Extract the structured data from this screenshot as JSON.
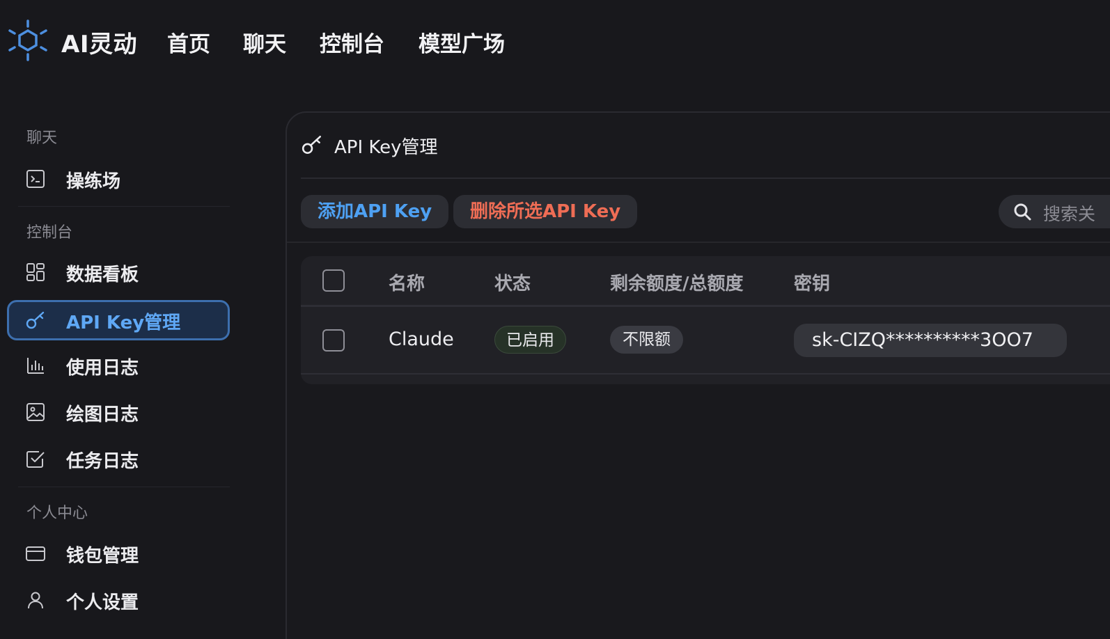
{
  "header": {
    "brand": "AI灵动",
    "nav": [
      "首页",
      "聊天",
      "控制台",
      "模型广场"
    ]
  },
  "sidebar": {
    "sections": [
      {
        "label": "聊天",
        "items": [
          {
            "label": "操练场",
            "icon": "terminal-icon"
          }
        ]
      },
      {
        "label": "控制台",
        "items": [
          {
            "label": "数据看板",
            "icon": "dashboard-grid-icon"
          },
          {
            "label": "API Key管理",
            "icon": "key-icon",
            "active": true
          },
          {
            "label": "使用日志",
            "icon": "bar-chart-icon"
          },
          {
            "label": "绘图日志",
            "icon": "image-icon"
          },
          {
            "label": "任务日志",
            "icon": "checkbox-icon"
          }
        ]
      },
      {
        "label": "个人中心",
        "items": [
          {
            "label": "钱包管理",
            "icon": "credit-card-icon"
          },
          {
            "label": "个人设置",
            "icon": "user-icon"
          }
        ]
      }
    ]
  },
  "main": {
    "title": "API Key管理",
    "add_button": "添加API Key",
    "delete_button": "删除所选API Key",
    "search_placeholder": "搜索关",
    "table": {
      "columns": [
        "名称",
        "状态",
        "剩余额度/总额度",
        "密钥"
      ],
      "rows": [
        {
          "name": "Claude",
          "status": "已启用",
          "quota": "不限额",
          "key": "sk-CIZQ**********3OO7"
        }
      ]
    }
  },
  "colors": {
    "accent": "#4ea1f3",
    "danger": "#ef6d55",
    "background": "#18181c"
  }
}
